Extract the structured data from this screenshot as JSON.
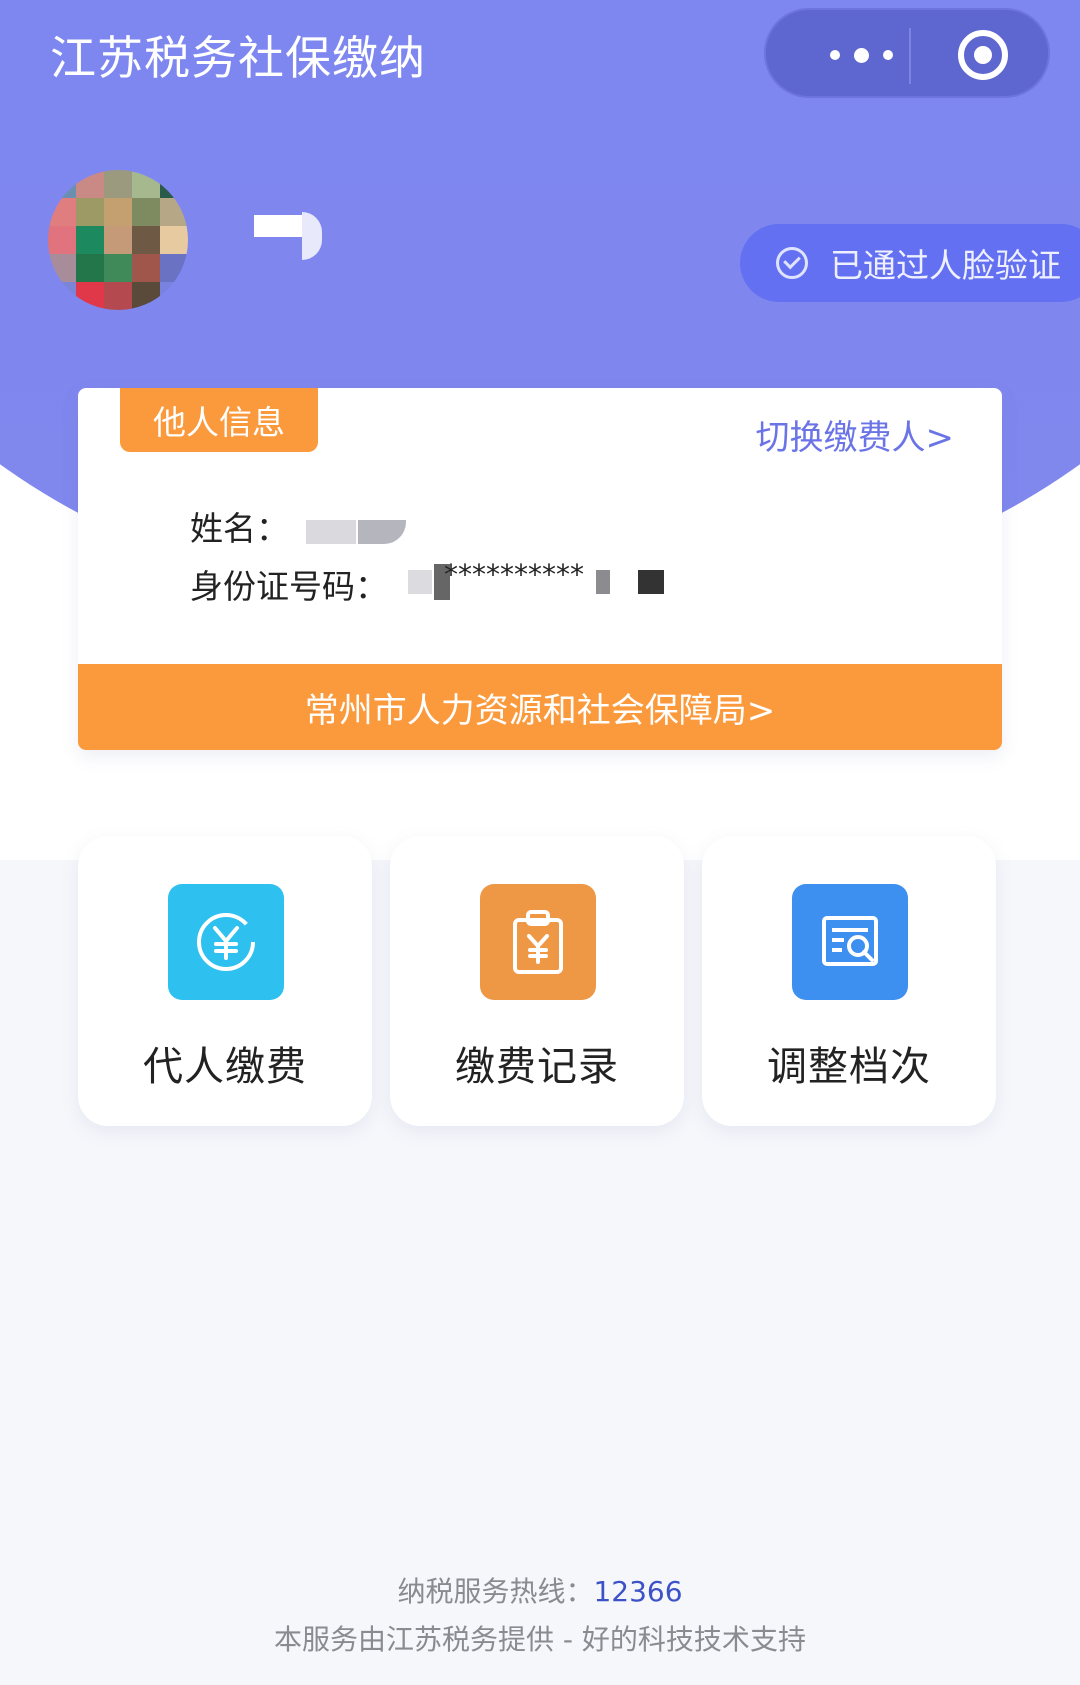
{
  "header": {
    "title": "江苏税务社保缴纳",
    "more_icon": "more-dots-icon",
    "close_icon": "target-circle-icon"
  },
  "profile": {
    "face_verified_label": "已通过人脸验证"
  },
  "card": {
    "tag_label": "他人信息",
    "switch_label": "切换缴费人>",
    "name_label": "姓名：",
    "id_label": "身份证号码：",
    "id_stars": "**********",
    "bureau_label": "常州市人力资源和社会保障局>"
  },
  "actions": [
    {
      "label": "代人缴费",
      "icon": "yuan-circle-icon",
      "color": "#2ec0ee"
    },
    {
      "label": "缴费记录",
      "icon": "clipboard-yuan-icon",
      "color": "#ee9846"
    },
    {
      "label": "调整档次",
      "icon": "document-search-icon",
      "color": "#3d8ff0"
    }
  ],
  "footer": {
    "hotline_label": "纳税服务热线：",
    "hotline_number": "12366",
    "support_text": "本服务由江苏税务提供 - 好的科技技术支持"
  },
  "colors": {
    "header_bg": "#7c86f2",
    "accent_orange": "#fb9a3d",
    "link_purple": "#6b74e6"
  }
}
